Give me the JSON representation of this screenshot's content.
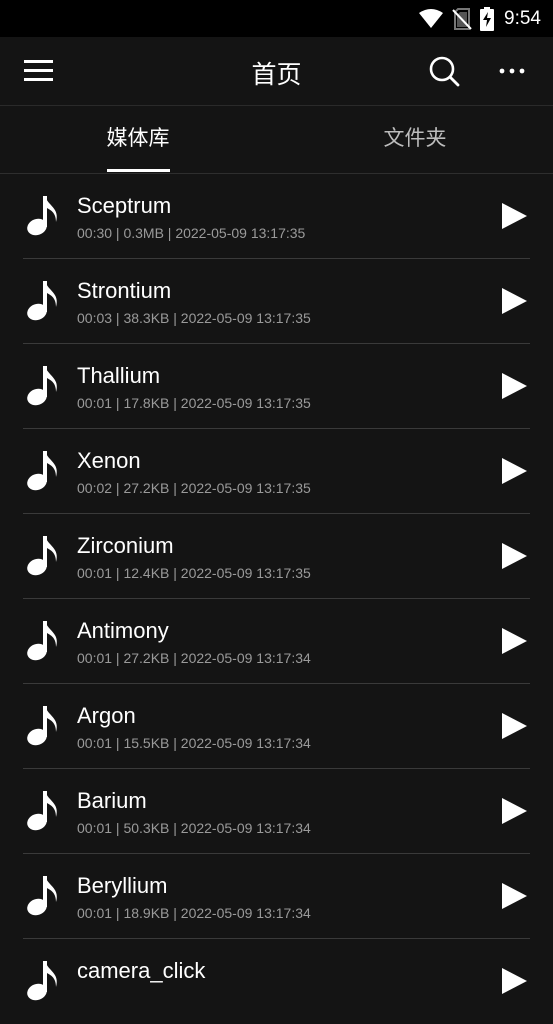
{
  "status_bar": {
    "time": "9:54",
    "icons": [
      "wifi-icon",
      "no-sim-icon",
      "battery-charging-icon"
    ]
  },
  "app_bar": {
    "title": "首页",
    "icons": [
      "menu-icon",
      "search-icon",
      "more-icon"
    ]
  },
  "tabs": [
    {
      "label": "媒体库",
      "selected": true
    },
    {
      "label": "文件夹",
      "selected": false
    }
  ],
  "list": [
    {
      "name": "Sceptrum",
      "meta": "00:30 | 0.3MB | 2022-05-09 13:17:35"
    },
    {
      "name": "Strontium",
      "meta": "00:03 | 38.3KB | 2022-05-09 13:17:35"
    },
    {
      "name": "Thallium",
      "meta": "00:01 | 17.8KB | 2022-05-09 13:17:35"
    },
    {
      "name": "Xenon",
      "meta": "00:02 | 27.2KB | 2022-05-09 13:17:35"
    },
    {
      "name": "Zirconium",
      "meta": "00:01 | 12.4KB | 2022-05-09 13:17:35"
    },
    {
      "name": "Antimony",
      "meta": "00:01 | 27.2KB | 2022-05-09 13:17:34"
    },
    {
      "name": "Argon",
      "meta": "00:01 | 15.5KB | 2022-05-09 13:17:34"
    },
    {
      "name": "Barium",
      "meta": "00:01 | 50.3KB | 2022-05-09 13:17:34"
    },
    {
      "name": "Beryllium",
      "meta": "00:01 | 18.9KB | 2022-05-09 13:17:34"
    },
    {
      "name": "camera_click",
      "meta": ""
    }
  ],
  "colors": {
    "background": "#141414",
    "status_bar": "#000000",
    "text_primary": "#ffffff",
    "text_secondary": "#9a9a9a",
    "divider": "#3a3a3a"
  }
}
